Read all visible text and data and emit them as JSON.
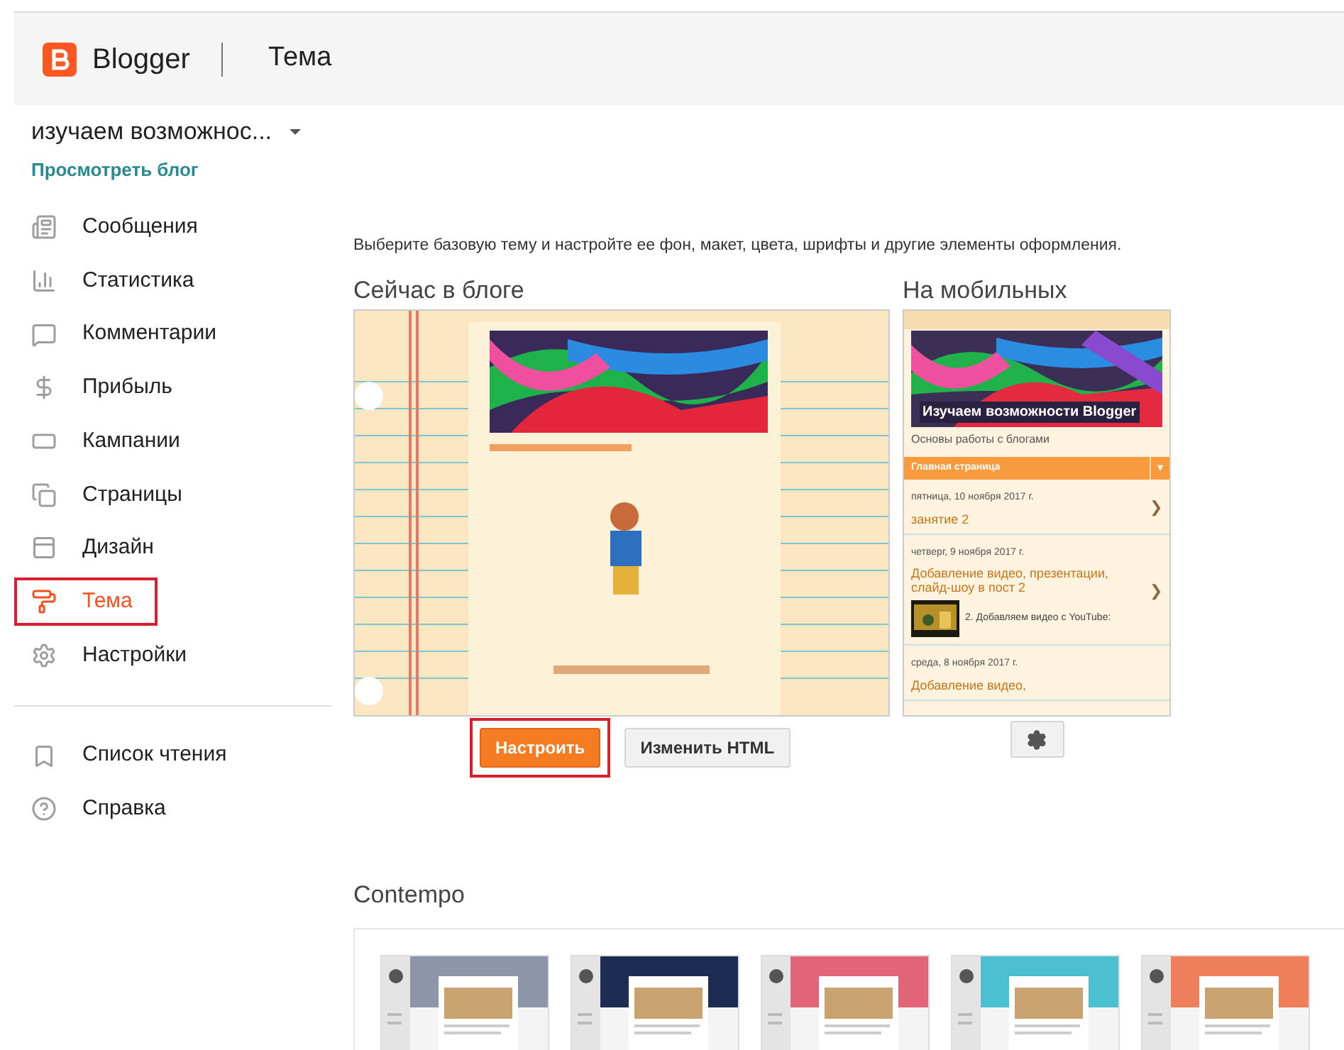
{
  "header": {
    "app_name": "Blogger",
    "page_title": "Тема"
  },
  "sidebar": {
    "blog_name": "изучаем возможнос...",
    "view_blog_link": "Просмотреть блог",
    "items": [
      {
        "label": "Сообщения",
        "selected": false,
        "highlighted": false
      },
      {
        "label": "Статистика",
        "selected": false,
        "highlighted": false
      },
      {
        "label": "Комментарии",
        "selected": false,
        "highlighted": false
      },
      {
        "label": "Прибыль",
        "selected": false,
        "highlighted": false
      },
      {
        "label": "Кампании",
        "selected": false,
        "highlighted": false
      },
      {
        "label": "Страницы",
        "selected": false,
        "highlighted": false
      },
      {
        "label": "Дизайн",
        "selected": false,
        "highlighted": false
      },
      {
        "label": "Тема",
        "selected": true,
        "highlighted": true
      },
      {
        "label": "Настройки",
        "selected": false,
        "highlighted": false
      }
    ],
    "secondary_items": [
      {
        "label": "Список чтения"
      },
      {
        "label": "Справка"
      }
    ]
  },
  "main": {
    "description": "Выберите базовую тему и настройте ее фон, макет, цвета, шрифты и другие элементы оформления.",
    "current": {
      "heading": "Сейчас в блоге",
      "buttons": [
        {
          "label": "Настроить",
          "kind": "primary",
          "highlighted": true
        },
        {
          "label": "Изменить HTML",
          "kind": "secondary",
          "highlighted": false
        }
      ]
    },
    "mobile": {
      "heading": "На мобильных",
      "blog_title": "Изучаем возможности Blogger",
      "blog_subtitle": "Основы работы с блогами",
      "nav_label": "Главная страница",
      "nav_caret": "▾",
      "posts": [
        {
          "date": "пятница, 10 ноября 2017 г.",
          "title": "занятие 2",
          "chevron": "❯"
        },
        {
          "date": "четверг, 9 ноября 2017 г.",
          "title": "Добавление видео, презентации, слайд-шоу в пост 2",
          "snippet": "2. Добавляем видео с YouTube:",
          "chevron": "❯"
        },
        {
          "date": "среда, 8 ноября 2017 г.",
          "title": "Добавление видео,"
        }
      ]
    },
    "gallery": {
      "heading": "Contempo",
      "themes": [
        {
          "color": "#8c96a8"
        },
        {
          "color": "#1c2c52"
        },
        {
          "color": "#e26478"
        },
        {
          "color": "#4cbfd0"
        },
        {
          "color": "#ef7f5a"
        }
      ]
    }
  }
}
